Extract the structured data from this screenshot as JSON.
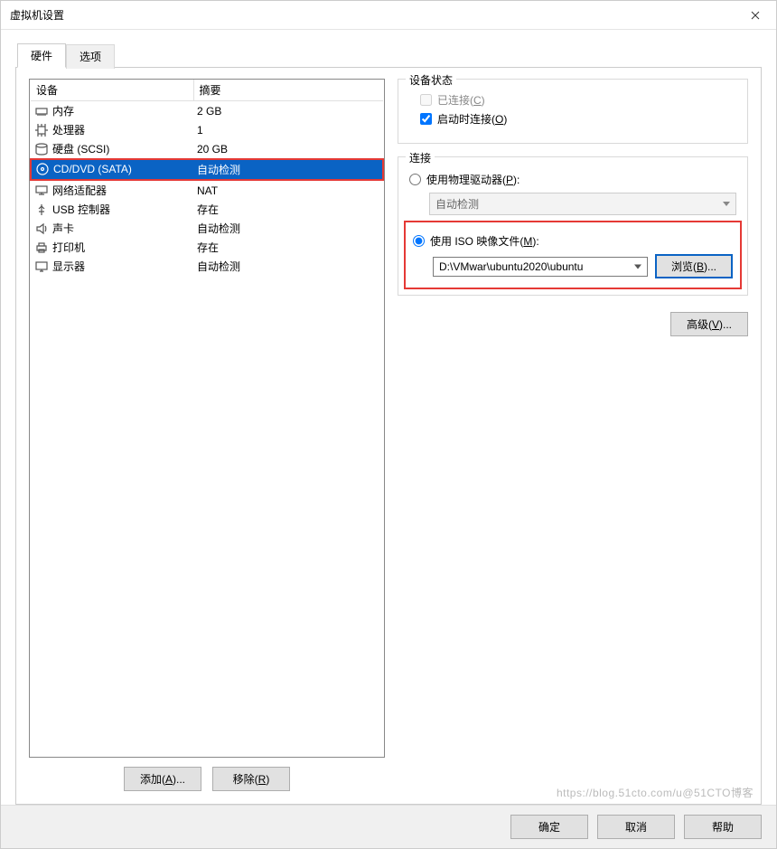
{
  "window": {
    "title": "虚拟机设置"
  },
  "tabs": {
    "hardware": "硬件",
    "options": "选项"
  },
  "table": {
    "col_device": "设备",
    "col_summary": "摘要",
    "rows": [
      {
        "icon": "memory-icon",
        "name": "内存",
        "summary": "2 GB"
      },
      {
        "icon": "cpu-icon",
        "name": "处理器",
        "summary": "1"
      },
      {
        "icon": "disk-icon",
        "name": "硬盘 (SCSI)",
        "summary": "20 GB"
      },
      {
        "icon": "cd-icon",
        "name": "CD/DVD (SATA)",
        "summary": "自动检测"
      },
      {
        "icon": "network-icon",
        "name": "网络适配器",
        "summary": "NAT"
      },
      {
        "icon": "usb-icon",
        "name": "USB 控制器",
        "summary": "存在"
      },
      {
        "icon": "sound-icon",
        "name": "声卡",
        "summary": "自动检测"
      },
      {
        "icon": "printer-icon",
        "name": "打印机",
        "summary": "存在"
      },
      {
        "icon": "display-icon",
        "name": "显示器",
        "summary": "自动检测"
      }
    ],
    "selected_index": 3
  },
  "buttons": {
    "add": "添加(A)...",
    "remove": "移除(R)",
    "ok": "确定",
    "cancel": "取消",
    "help": "帮助",
    "browse": "浏览(B)...",
    "advanced": "高级(V)..."
  },
  "status_group": {
    "legend": "设备状态",
    "connected": "已连接(C)",
    "connect_at_power_on": "启动时连接(O)"
  },
  "connect_group": {
    "legend": "连接",
    "use_physical": "使用物理驱动器(P):",
    "physical_value": "自动检测",
    "use_iso": "使用 ISO 映像文件(M):",
    "iso_path": "D:\\VMwar\\ubuntu2020\\ubuntu"
  },
  "watermark": "https://blog.51cto.com/u@51CTO博客"
}
